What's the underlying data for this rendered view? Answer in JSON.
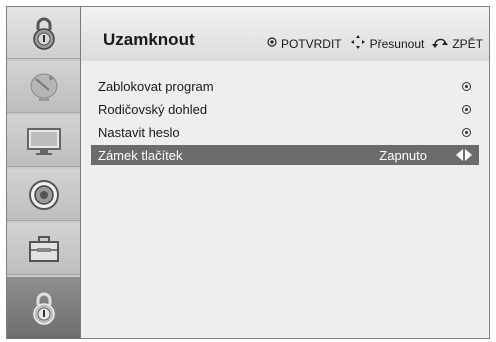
{
  "header": {
    "title": "Uzamknout",
    "hints": {
      "confirm": "POTVRDIT",
      "move": "Přesunout",
      "back": "ZPĚT"
    }
  },
  "sidebar": {
    "items": [
      {
        "icon": "padlock-icon"
      },
      {
        "icon": "satellite-dish-icon"
      },
      {
        "icon": "tv-screen-icon"
      },
      {
        "icon": "speaker-icon"
      },
      {
        "icon": "toolbox-icon"
      },
      {
        "icon": "padlock-icon"
      }
    ]
  },
  "menu": {
    "items": [
      {
        "label": "Zablokovat program"
      },
      {
        "label": "Rodičovský dohled"
      },
      {
        "label": "Nastavit heslo"
      },
      {
        "label": "Zámek tlačítek",
        "value": "Zapnuto"
      }
    ]
  },
  "colors": {
    "selected_row": "#6b6b6b",
    "sidebar": "#c9c9c9",
    "panel": "#eeeeee"
  }
}
